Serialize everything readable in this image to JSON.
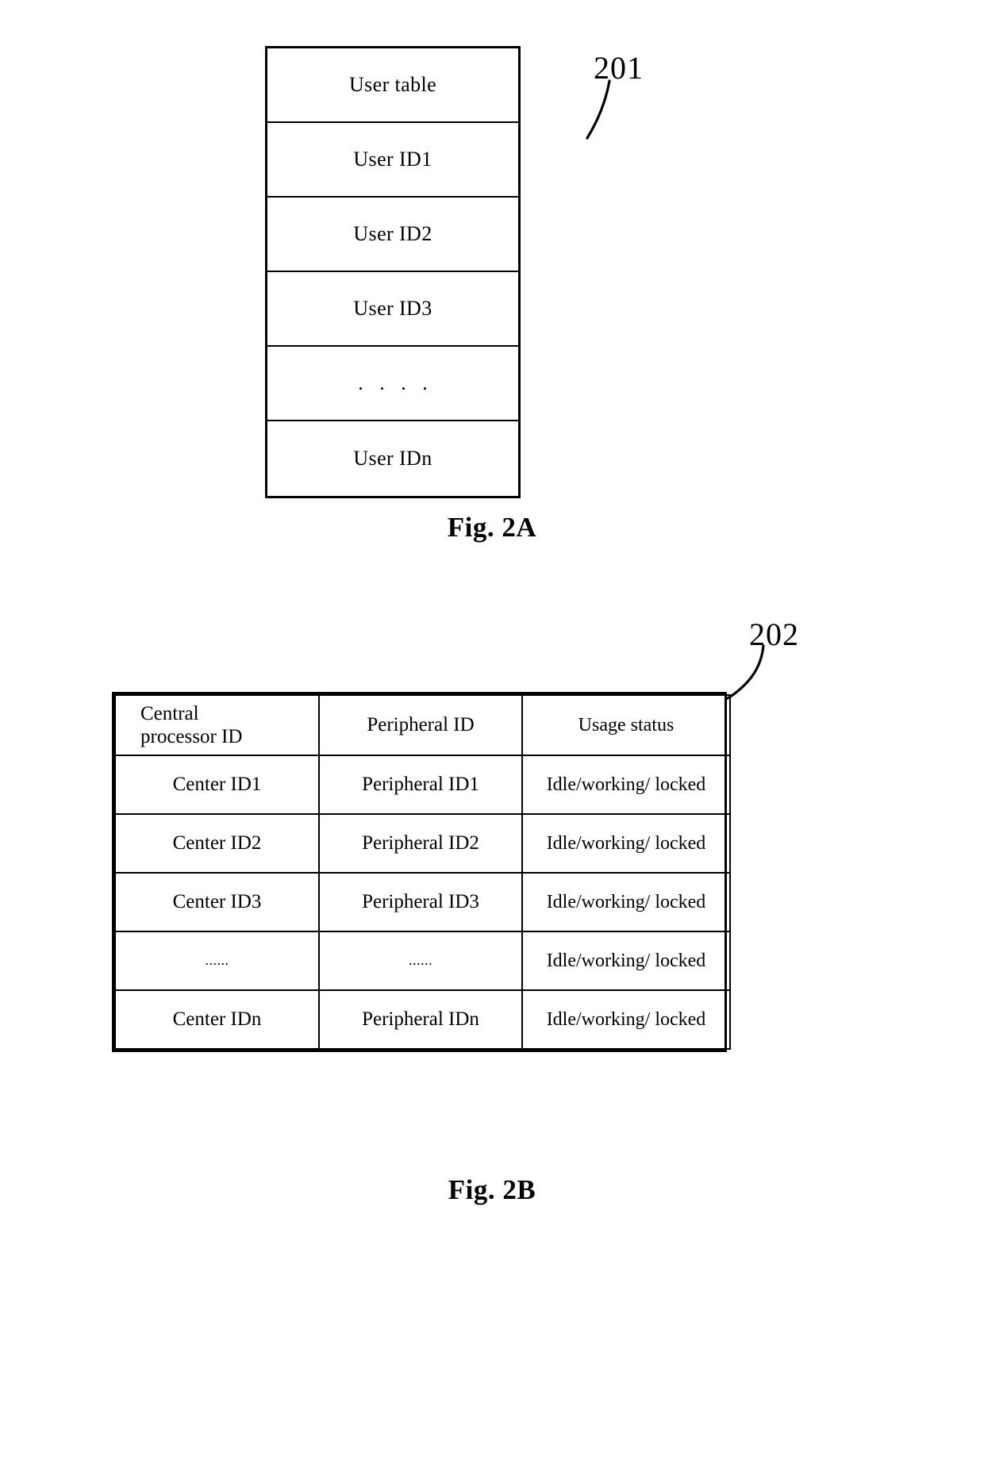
{
  "figures": [
    {
      "id": "fig-2a",
      "caption": "Fig. 2A",
      "reference_numeral": "201",
      "table": {
        "name": "user-table",
        "rows": [
          "User table",
          "User ID1",
          "User ID2",
          "User ID3",
          ". . . .",
          "User IDn"
        ]
      }
    },
    {
      "id": "fig-2b",
      "caption": "Fig. 2B",
      "reference_numeral": "202",
      "table": {
        "name": "peripheral-allocation-table",
        "headers": [
          "Central\nprocessor ID",
          "Peripheral ID",
          "Usage status"
        ],
        "header_line1": "Central",
        "header_line2": "processor ID",
        "rows": [
          {
            "center_id": "Center ID1",
            "peripheral_id": "Peripheral ID1",
            "usage_status": "Idle/working/ locked"
          },
          {
            "center_id": "Center ID2",
            "peripheral_id": "Peripheral ID2",
            "usage_status": "Idle/working/ locked"
          },
          {
            "center_id": "Center ID3",
            "peripheral_id": "Peripheral ID3",
            "usage_status": "Idle/working/ locked"
          },
          {
            "center_id": "......",
            "peripheral_id": "......",
            "usage_status": "Idle/working/ locked"
          },
          {
            "center_id": "Center IDn",
            "peripheral_id": "Peripheral IDn",
            "usage_status": "Idle/working/ locked"
          }
        ]
      }
    }
  ],
  "colors": {
    "ink": "#000000",
    "background": "#ffffff"
  }
}
